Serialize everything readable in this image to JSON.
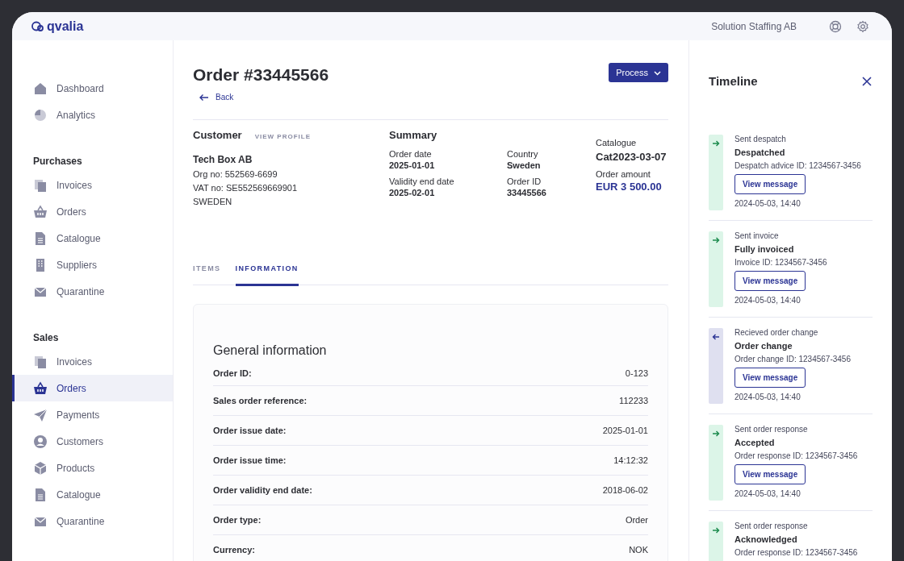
{
  "header": {
    "logo": "qvalia",
    "company": "Solution Staffing AB"
  },
  "sidebar": {
    "sections": [
      {
        "items": [
          {
            "label": "Dashboard",
            "selected": false
          },
          {
            "label": "Analytics",
            "selected": false
          }
        ]
      },
      {
        "title": "Purchases",
        "items": [
          {
            "label": "Invoices",
            "selected": false
          },
          {
            "label": "Orders",
            "selected": false
          },
          {
            "label": "Catalogue",
            "selected": false
          },
          {
            "label": "Suppliers",
            "selected": false
          },
          {
            "label": "Quarantine",
            "selected": false
          }
        ]
      },
      {
        "title": "Sales",
        "items": [
          {
            "label": "Invoices",
            "selected": false
          },
          {
            "label": "Orders",
            "selected": true
          },
          {
            "label": "Payments",
            "selected": false
          },
          {
            "label": "Customers",
            "selected": false
          },
          {
            "label": "Products",
            "selected": false
          },
          {
            "label": "Catalogue",
            "selected": false
          },
          {
            "label": "Quarantine",
            "selected": false
          }
        ]
      }
    ]
  },
  "order": {
    "title": "Order #33445566",
    "back": "Back",
    "process_button": "Process",
    "customer": {
      "heading": "Customer",
      "link": "VIEW PROFILE",
      "name": "Tech Box AB",
      "lines": [
        "Org no: 552569-6699",
        "VAT no: SE552569669901",
        "SWEDEN"
      ]
    },
    "summary": {
      "heading": "Summary",
      "columns": [
        [
          {
            "label": "Order date",
            "value": "2025-01-01",
            "kind": "plain"
          },
          {
            "label": "Validity end date",
            "value": "2025-02-01",
            "kind": "plain"
          }
        ],
        [
          {
            "label": "Country",
            "value": "Sweden",
            "kind": "plain"
          },
          {
            "label": "Order ID",
            "value": "33445566",
            "kind": "plain"
          }
        ],
        [
          {
            "label": "Catalogue",
            "value": "Cat2023-03-07",
            "kind": "large"
          },
          {
            "label": "Order amount",
            "value": "EUR  3 500.00",
            "kind": "amount"
          }
        ]
      ]
    },
    "tabs": [
      {
        "label": "ITEMS",
        "selected": false
      },
      {
        "label": "INFORMATION",
        "selected": true
      }
    ],
    "general": {
      "heading": "General information",
      "rows": [
        {
          "label": "Order ID:",
          "value": "0-123"
        },
        {
          "label": "Sales order reference:",
          "value": "112233"
        },
        {
          "label": "Order issue date:",
          "value": "2025-01-01"
        },
        {
          "label": "Order issue time:",
          "value": "14:12:32"
        },
        {
          "label": "Order validity end date:",
          "value": "2018-06-02"
        },
        {
          "label": "Order type:",
          "value": "Order"
        },
        {
          "label": "Currency:",
          "value": "NOK"
        }
      ]
    }
  },
  "timeline": {
    "title": "Timeline",
    "entries": [
      {
        "kind": "outgoing",
        "event": "Sent despatch",
        "status": "Despatched",
        "reference": "Despatch advice ID: 1234567-3456",
        "button": "View message",
        "time": "2024-05-03, 14:40"
      },
      {
        "kind": "outgoing",
        "event": "Sent invoice",
        "status": "Fully invoiced",
        "reference": "Invoice ID: 1234567-3456",
        "button": "View message",
        "time": "2024-05-03, 14:40"
      },
      {
        "kind": "incoming",
        "event": "Recieved order change",
        "status": "Order change",
        "reference": "Order change ID: 1234567-3456",
        "button": "View message",
        "time": "2024-05-03, 14:40"
      },
      {
        "kind": "outgoing",
        "event": "Sent order response",
        "status": "Accepted",
        "reference": "Order response ID: 1234567-3456",
        "button": "View message",
        "time": "2024-05-03, 14:40"
      },
      {
        "kind": "outgoing",
        "event": "Sent order response",
        "status": "Acknowledged",
        "reference": "Order response ID: 1234567-3456"
      }
    ]
  }
}
